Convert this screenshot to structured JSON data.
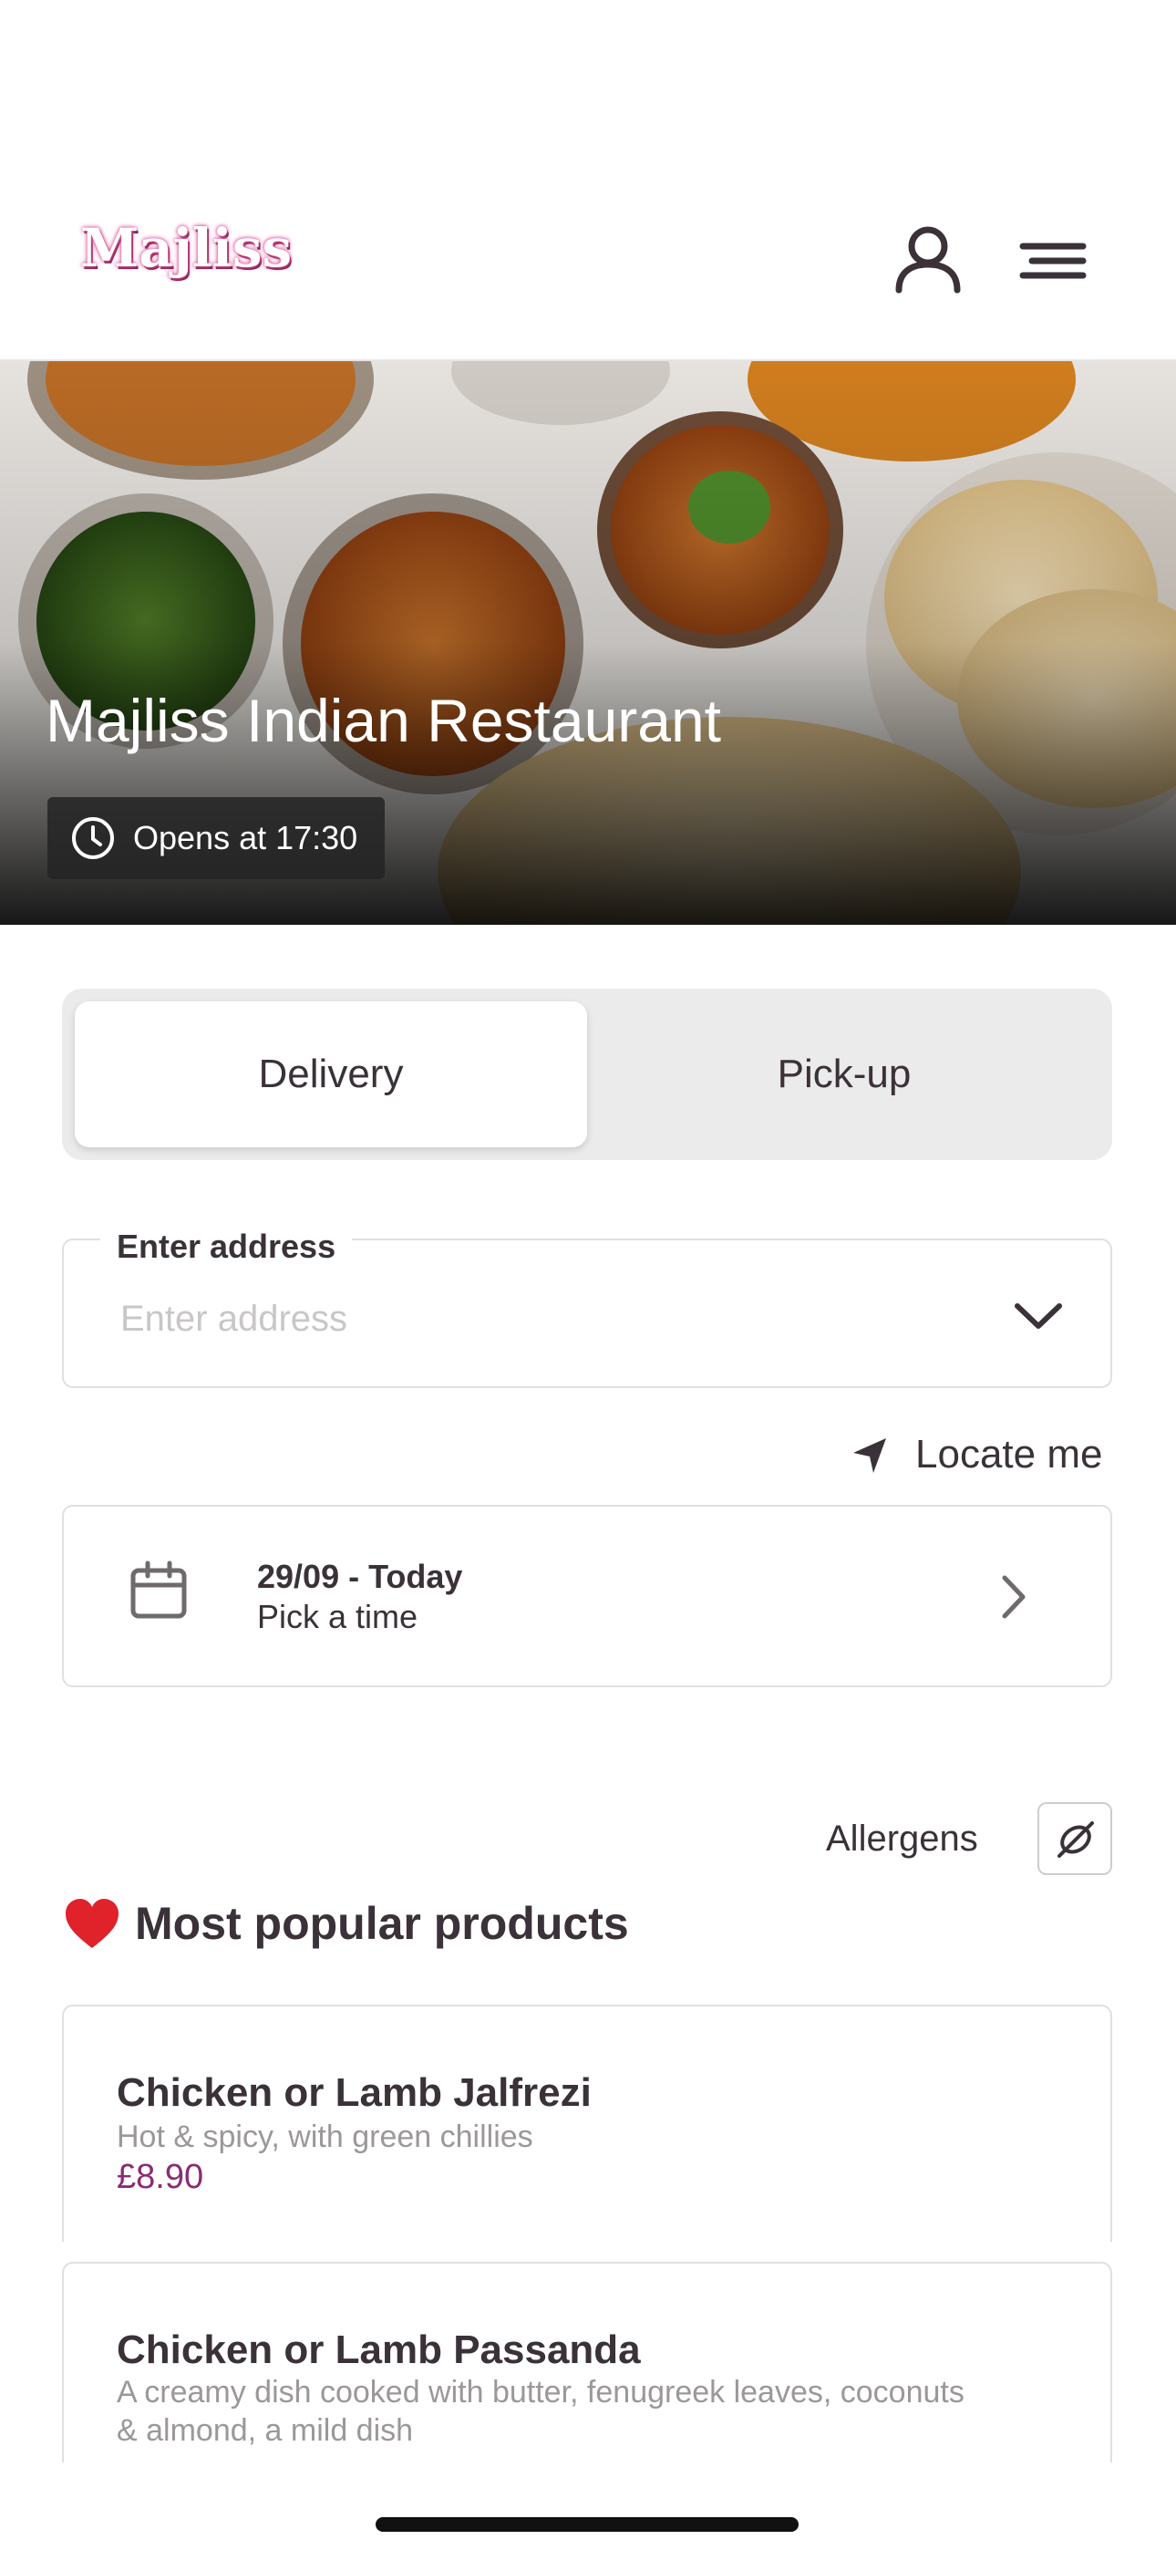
{
  "brand": {
    "logo_text": "Majliss"
  },
  "hero": {
    "title": "Majliss Indian Restaurant",
    "hours": "Opens at 17:30"
  },
  "order_mode": {
    "options": [
      "Delivery",
      "Pick-up"
    ],
    "selected": "Delivery"
  },
  "address": {
    "label": "Enter address",
    "placeholder": "Enter address",
    "value": ""
  },
  "locate": {
    "label": "Locate me"
  },
  "schedule": {
    "date": "29/09 - Today",
    "time_prompt": "Pick a time"
  },
  "allergens": {
    "label": "Allergens"
  },
  "popular": {
    "title": "Most popular products",
    "items": [
      {
        "name": "Chicken or Lamb Jalfrezi",
        "description": "Hot & spicy, with green chillies",
        "price": "£8.90"
      },
      {
        "name": "Chicken or Lamb Passanda",
        "description": "A creamy dish cooked with butter, fenugreek leaves, coconuts & almond, a mild dish",
        "price": ""
      }
    ]
  },
  "colors": {
    "accent": "#8a2c74",
    "logo_glow": "#e0589b",
    "text": "#3a3238"
  },
  "icons": [
    "user-icon",
    "menu-icon",
    "clock-icon",
    "chevron-down-icon",
    "location-arrow-icon",
    "calendar-icon",
    "chevron-right-icon",
    "allergen-icon",
    "heart-icon"
  ]
}
